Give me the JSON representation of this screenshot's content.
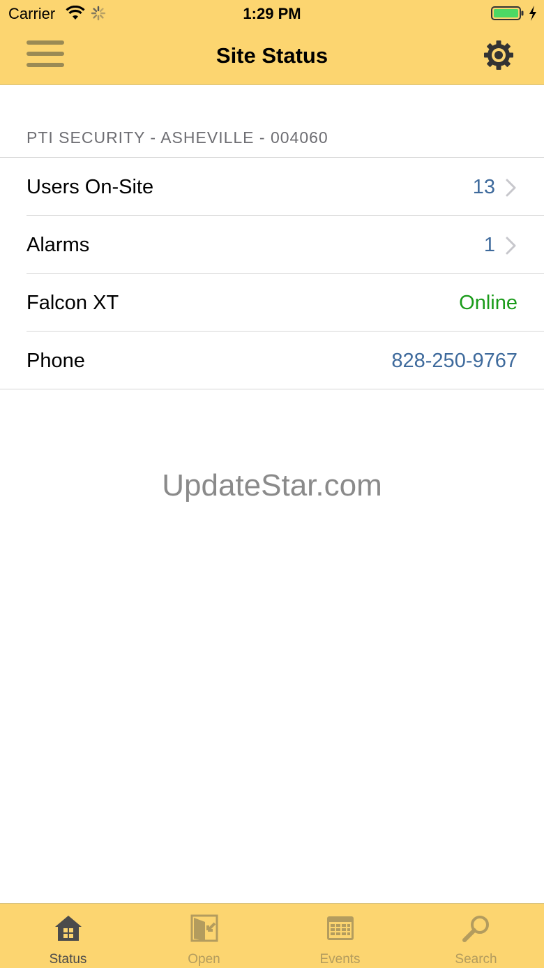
{
  "status_bar": {
    "carrier": "Carrier",
    "time": "1:29 PM"
  },
  "nav": {
    "title": "Site Status",
    "menu_icon": "hamburger-menu-icon",
    "settings_icon": "gear-icon"
  },
  "site": {
    "header": "PTI SECURITY - ASHEVILLE - 004060"
  },
  "rows": [
    {
      "label": "Users On-Site",
      "value": "13",
      "value_color": "#3e6a9c",
      "chevron": true
    },
    {
      "label": "Alarms",
      "value": "1",
      "value_color": "#3e6a9c",
      "chevron": true
    },
    {
      "label": "Falcon XT",
      "value": "Online",
      "value_color": "#1a9b1a",
      "chevron": false
    },
    {
      "label": "Phone",
      "value": "828-250-9767",
      "value_color": "#3e6a9c",
      "chevron": false
    }
  ],
  "watermark": "UpdateStar.com",
  "tabs": [
    {
      "label": "Status",
      "icon": "house-icon",
      "active": true
    },
    {
      "label": "Open",
      "icon": "open-door-icon",
      "active": false
    },
    {
      "label": "Events",
      "icon": "calendar-icon",
      "active": false
    },
    {
      "label": "Search",
      "icon": "magnifier-icon",
      "active": false
    }
  ],
  "colors": {
    "bar_yellow": "#fcd570",
    "link_blue": "#3e6a9c",
    "online_green": "#1a9b1a"
  }
}
